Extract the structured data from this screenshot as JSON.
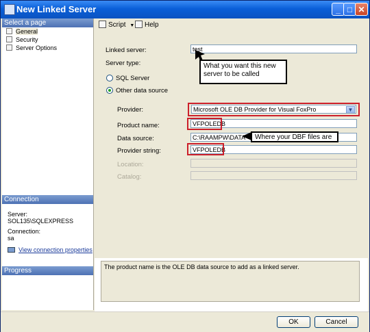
{
  "window": {
    "title": "New Linked Server"
  },
  "left_panel": {
    "select_page_header": "Select a page",
    "pages": [
      {
        "label": "General",
        "selected": true
      },
      {
        "label": "Security",
        "selected": false
      },
      {
        "label": "Server Options",
        "selected": false
      }
    ],
    "connection_header": "Connection",
    "server_label": "Server:",
    "server_value": "SOL135\\SQLEXPRESS",
    "connection_label": "Connection:",
    "connection_value": "sa",
    "view_connection_link": "View connection properties",
    "progress_header": "Progress"
  },
  "toolbar": {
    "script_label": "Script",
    "help_label": "Help"
  },
  "form": {
    "linked_server_label": "Linked server:",
    "linked_server_value": "test",
    "server_type_label": "Server type:",
    "sql_server_label": "SQL Server",
    "other_source_label": "Other data source",
    "selected_server_type": "Other data source",
    "provider_label": "Provider:",
    "provider_value": "Microsoft OLE DB Provider for Visual FoxPro",
    "product_name_label": "Product name:",
    "product_name_value": "VFPOLEDB",
    "data_source_label": "Data source:",
    "data_source_value": "C:\\RAAMPW\\DATA",
    "provider_string_label": "Provider string:",
    "provider_string_value": "VFPOLEDB",
    "location_label": "Location:",
    "location_value": "",
    "catalog_label": "Catalog:",
    "catalog_value": ""
  },
  "annotations": {
    "server_name_note": "What you want this new server to be called",
    "dbf_note": "Where your DBF files are",
    "highlight_color": "#cc1f2a"
  },
  "description": "The product name is the OLE DB data source to add as a linked server.",
  "buttons": {
    "ok": "OK",
    "cancel": "Cancel"
  }
}
